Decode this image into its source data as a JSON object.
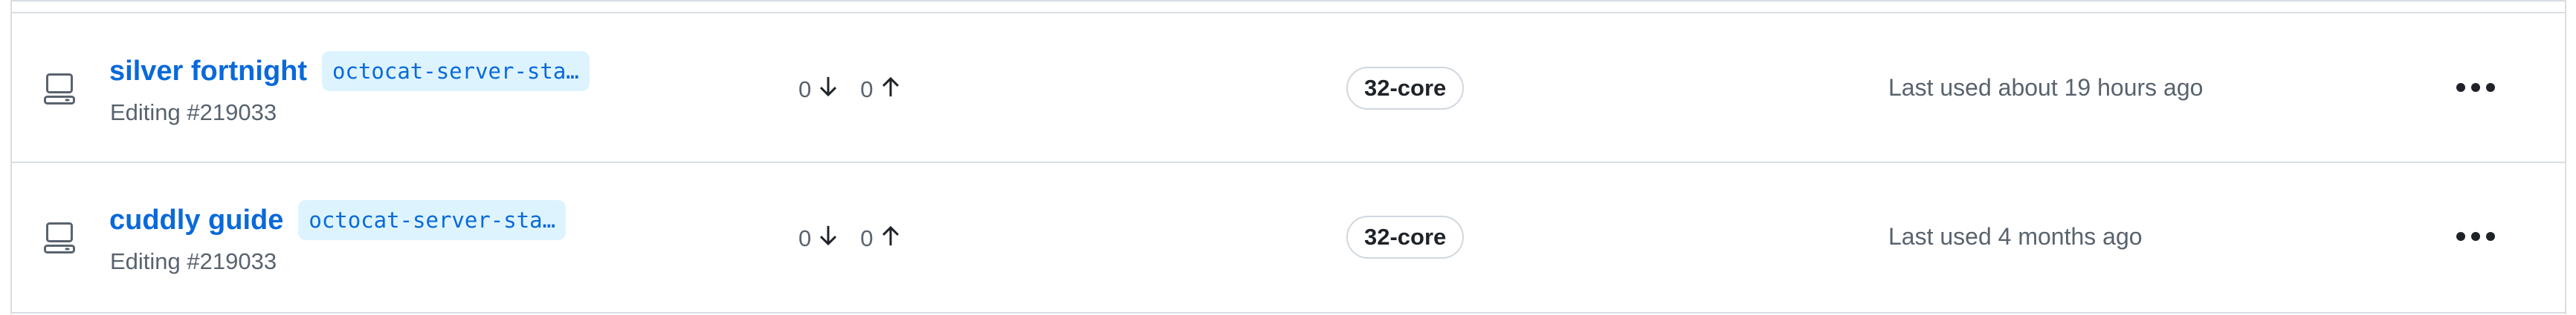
{
  "codespaces": [
    {
      "name": "silver fortnight",
      "branch": "octocat-server-sta…",
      "subtitle": "Editing #219033",
      "behind": "0",
      "ahead": "0",
      "machine": "32-core",
      "last_used": "Last used about 19 hours ago",
      "icons": {
        "machine": "codespace-machine-icon",
        "behind": "arrow-down-icon",
        "ahead": "arrow-up-icon",
        "more": "kebab-horizontal-icon"
      }
    },
    {
      "name": "cuddly guide",
      "branch": "octocat-server-sta…",
      "subtitle": "Editing #219033",
      "behind": "0",
      "ahead": "0",
      "machine": "32-core",
      "last_used": "Last used 4 months ago",
      "icons": {
        "machine": "codespace-machine-icon",
        "behind": "arrow-down-icon",
        "ahead": "arrow-up-icon",
        "more": "kebab-horizontal-icon"
      }
    }
  ],
  "colors": {
    "link": "#0969da",
    "branch_bg": "#ddf4ff",
    "muted_text": "#59636e",
    "border": "#d8dee4"
  }
}
